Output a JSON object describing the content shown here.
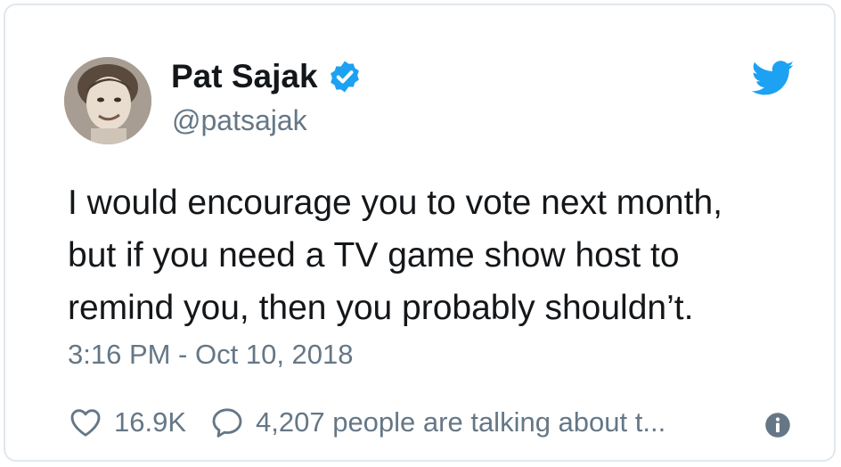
{
  "author": {
    "name": "Pat Sajak",
    "handle": "@patsajak",
    "verified": true,
    "avatar_icon": "profile-photo"
  },
  "tweet": {
    "text": "I would encourage you to vote next month,\nbut if you need a TV game show host to\nremind you, then you probably shouldn’t.",
    "timestamp": "3:16 PM - Oct 10, 2018"
  },
  "engagement": {
    "likes": "16.9K",
    "talking": "4,207 people are talking about t..."
  },
  "colors": {
    "twitter_blue": "#1da1f2",
    "text": "#14171a",
    "secondary_text": "#657786",
    "border": "#e1e8ed"
  },
  "icons": {
    "verified": "verified-badge-icon",
    "brand": "twitter-bird-icon",
    "like": "heart-icon",
    "reply": "speech-bubble-icon",
    "info": "info-icon"
  }
}
